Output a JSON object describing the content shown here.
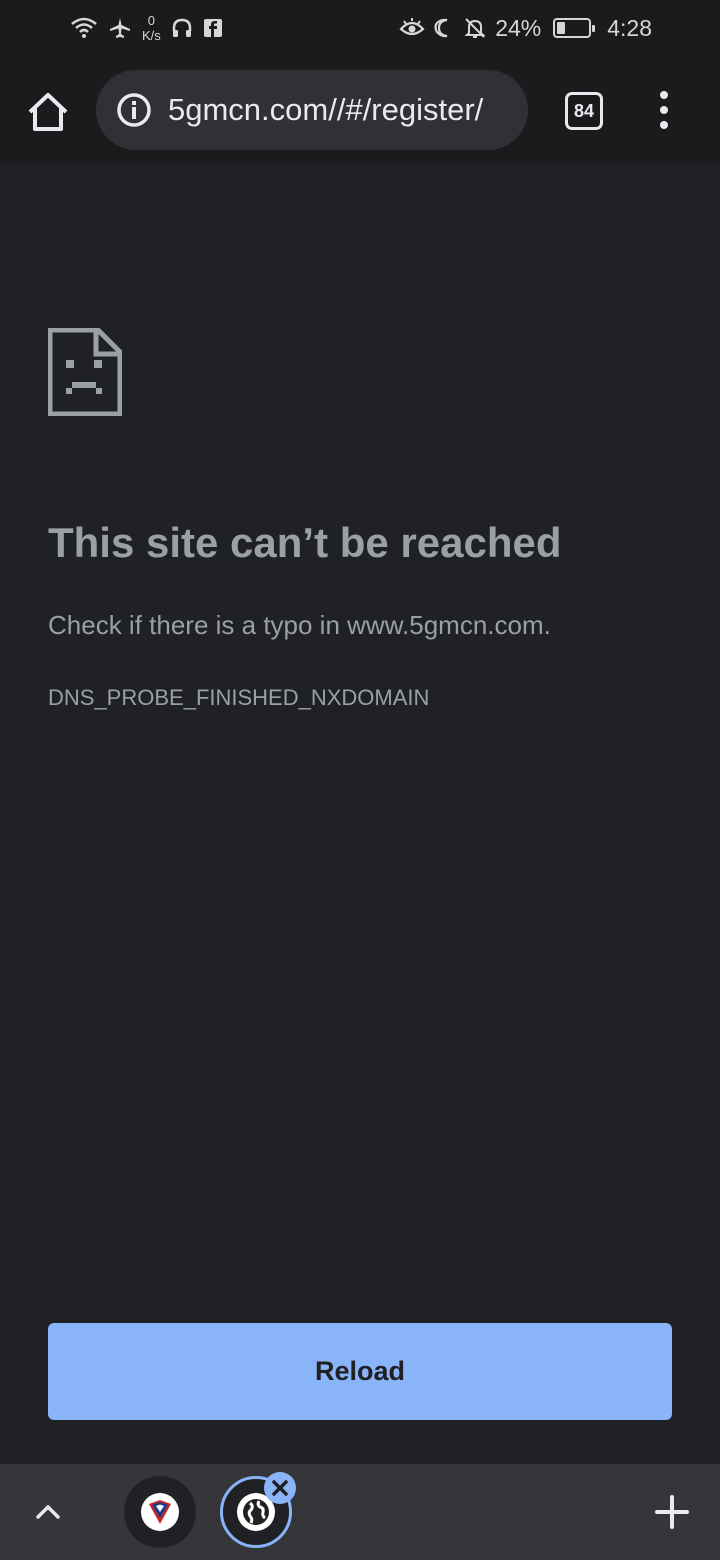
{
  "status_bar": {
    "netspeed_value": "0",
    "netspeed_unit": "K/s",
    "battery_percent": "24%",
    "time": "4:28",
    "icons": [
      "wifi-icon",
      "airplane-icon",
      "headphones-icon",
      "facebook-icon",
      "eye-icon",
      "moon-icon",
      "bell-off-icon",
      "battery-icon"
    ]
  },
  "toolbar": {
    "url": "5gmcn.com//#/register/",
    "tab_count": "84",
    "icons": [
      "home-icon",
      "info-icon",
      "more-vert-icon"
    ]
  },
  "error_page": {
    "heading": "This site can’t be reached",
    "suggestion": "Check if there is a typo in www.5gmcn.com.",
    "error_code": "DNS_PROBE_FINISHED_NXDOMAIN",
    "reload_label": "Reload"
  },
  "bottom_bar": {
    "icons": [
      "chevron-up-icon",
      "tab-favicon-icon",
      "globe-icon",
      "close-icon",
      "plus-icon"
    ]
  },
  "colors": {
    "background": "#202124",
    "toolbar": "#1b1b1d",
    "accent": "#8ab4f8",
    "text_secondary": "#9aa0a6"
  }
}
